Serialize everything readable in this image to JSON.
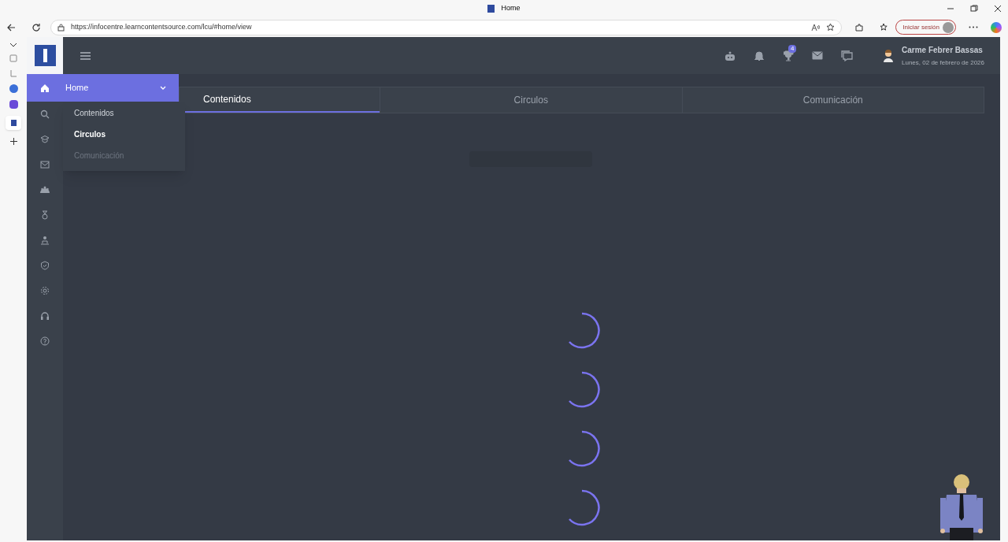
{
  "browser": {
    "tab_title": "Home",
    "url": "https://infocentre.learncontentsource.com/lcu/#home/view",
    "signin": "Iniciar sesión"
  },
  "header": {
    "badge": "4",
    "user_name": "Carme Febrer Bassas",
    "date": "Lunes, 02 de febrero de 2026"
  },
  "menu": {
    "label": "Home",
    "expanded": true,
    "children": [
      {
        "label": "Contenidos",
        "selected": false,
        "disabled": false
      },
      {
        "label": "Circulos",
        "selected": true,
        "disabled": false
      },
      {
        "label": "Comunicación",
        "selected": false,
        "disabled": true
      }
    ]
  },
  "tabs": [
    {
      "label": "Contenidos",
      "selected": true
    },
    {
      "label": "Circulos",
      "selected": false
    },
    {
      "label": "Comunicación",
      "selected": false
    }
  ]
}
